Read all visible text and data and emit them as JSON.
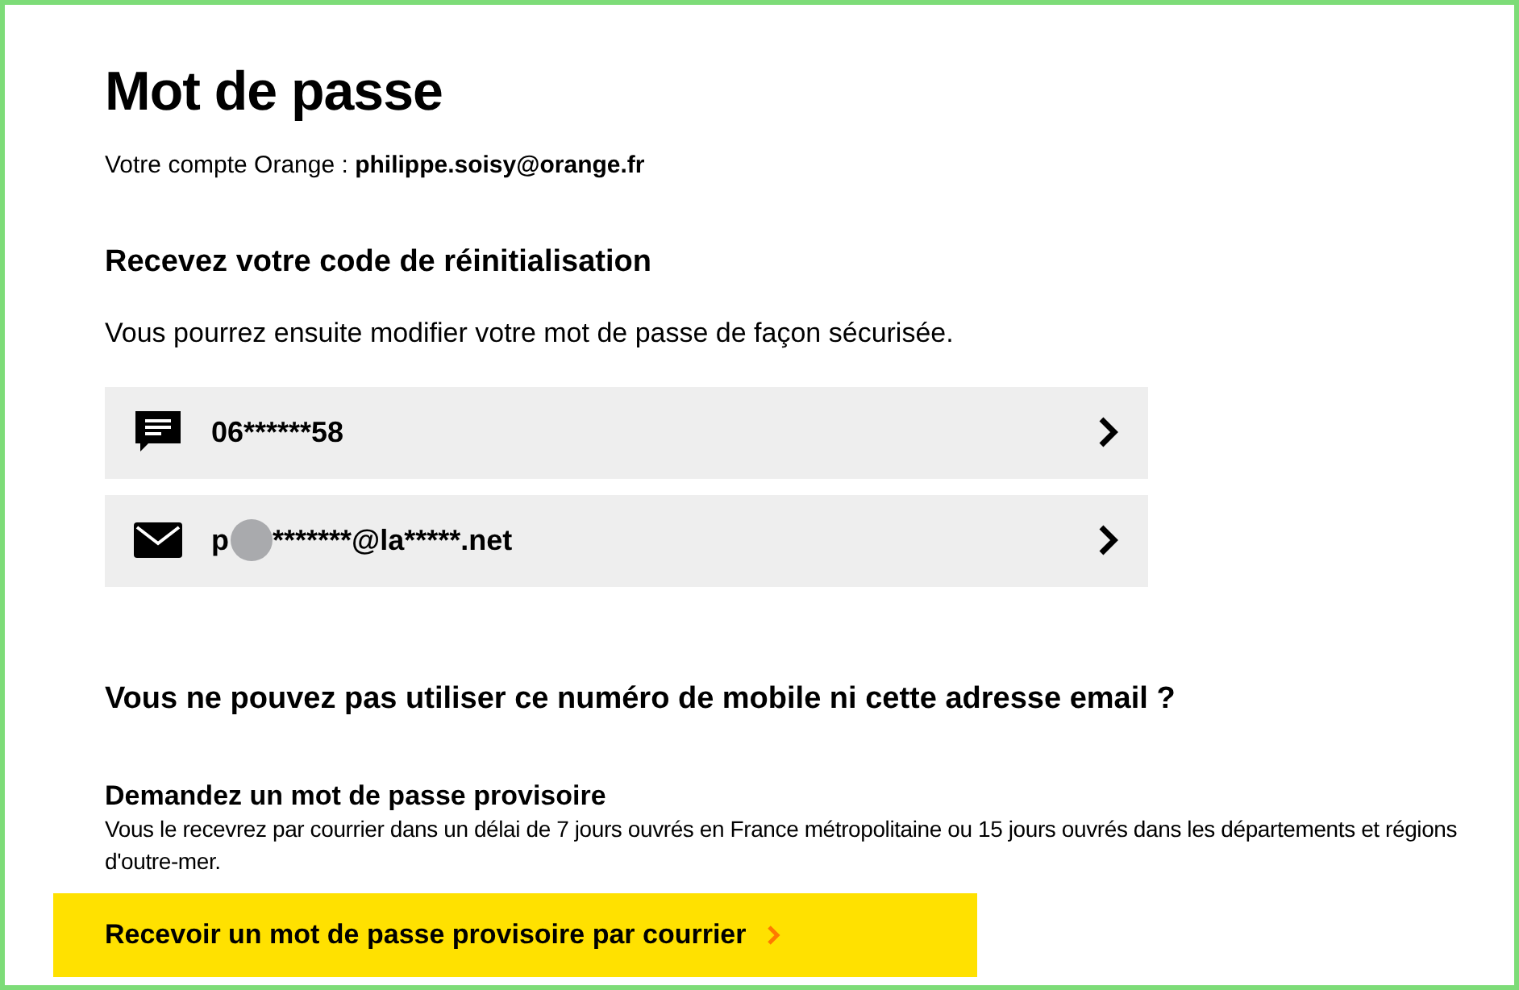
{
  "title": "Mot de passe",
  "account": {
    "label": "Votre compte Orange : ",
    "email": "philippe.soisy@orange.fr"
  },
  "section_title": "Recevez votre code de réinitialisation",
  "section_text": "Vous pourrez ensuite modifier votre mot de passe de façon sécurisée.",
  "options": [
    {
      "kind": "sms",
      "prefix": "06******58",
      "redacted": false
    },
    {
      "kind": "email",
      "prefix": "p",
      "redacted": true,
      "suffix": "*******@la*****.net"
    }
  ],
  "alt_question": "Vous ne pouvez pas utiliser ce numéro de mobile ni cette adresse email ?",
  "provisional": {
    "title": "Demandez un mot de passe provisoire",
    "text": "Vous le recevrez par courrier dans un délai de 7 jours ouvrés en France métropolitaine ou 15 jours ouvrés dans les départements et régions d'outre-mer.",
    "button": "Recevoir un mot de passe provisoire par courrier"
  }
}
